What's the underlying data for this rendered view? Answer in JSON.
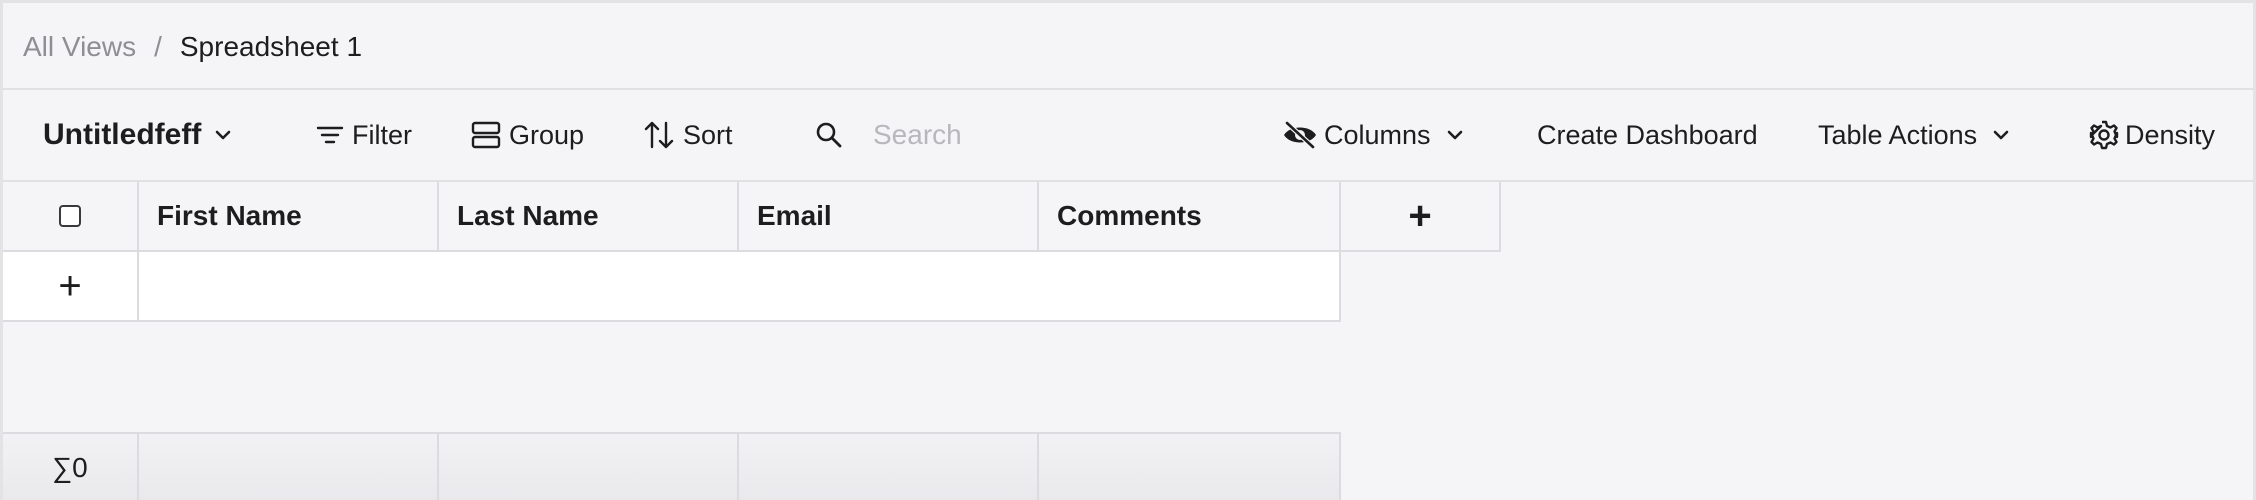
{
  "breadcrumb": {
    "root": "All Views",
    "separator": "/",
    "current": "Spreadsheet 1"
  },
  "toolbar": {
    "view_name": "Untitledfeff",
    "filter_label": "Filter",
    "group_label": "Group",
    "sort_label": "Sort",
    "search_placeholder": "Search",
    "search_value": "",
    "columns_label": "Columns",
    "create_dashboard_label": "Create Dashboard",
    "table_actions_label": "Table Actions",
    "density_label": "Density"
  },
  "table": {
    "columns": [
      "First Name",
      "Last Name",
      "Email",
      "Comments"
    ],
    "add_column_symbol": "+",
    "add_row_symbol": "+",
    "rows": [],
    "footer_summary": "∑0"
  },
  "icons": {
    "dropdown": "chevron-down-icon",
    "filter": "filter-lines-icon",
    "group": "group-rows-icon",
    "sort": "sort-arrows-icon",
    "search": "search-icon",
    "columns": "eye-slash-icon",
    "density": "gear-icon"
  },
  "colors": {
    "background": "#f5f5f7",
    "border": "#dcdce0",
    "text": "#1d1d1f",
    "muted": "#8e8e93",
    "placeholder": "#b8b8bc"
  }
}
